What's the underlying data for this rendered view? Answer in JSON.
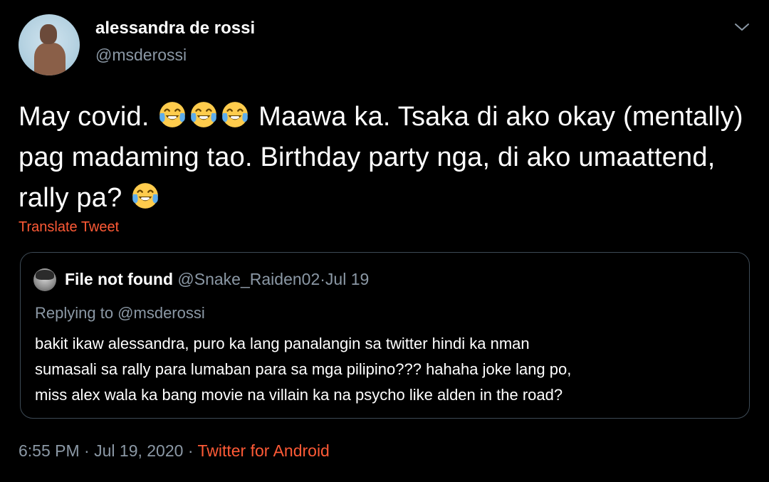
{
  "tweet": {
    "display_name": "alessandra de rossi",
    "handle": "@msderossi",
    "text_part1": "May covid. ",
    "text_part2": " Maawa ka. Tsaka di ako okay (mentally) pag madaming tao. Birthday party nga, di ako umaattend, rally pa? ",
    "emoji_icon": "face-with-tears-of-joy-icon",
    "translate_label": "Translate Tweet",
    "timestamp_time": "6:55 PM",
    "separator": "·",
    "timestamp_date": "Jul 19, 2020",
    "source": "Twitter for Android"
  },
  "quoted": {
    "display_name": "File not found",
    "handle": "@Snake_Raiden02",
    "date": "Jul 19",
    "separator": "·",
    "replying_to": "Replying to @msderossi",
    "lines": [
      "bakit ikaw alessandra, puro ka lang panalangin sa twitter hindi ka nman",
      "sumasali sa rally para lumaban para sa mga pilipino??? hahaha joke lang po,",
      "miss alex wala ka bang movie na villain ka na psycho like alden in the road?"
    ]
  },
  "colors": {
    "background": "#000000",
    "text": "#ffffff",
    "secondary_text": "#8b98a5",
    "accent": "#ff5a36",
    "border": "#3d4a55"
  }
}
